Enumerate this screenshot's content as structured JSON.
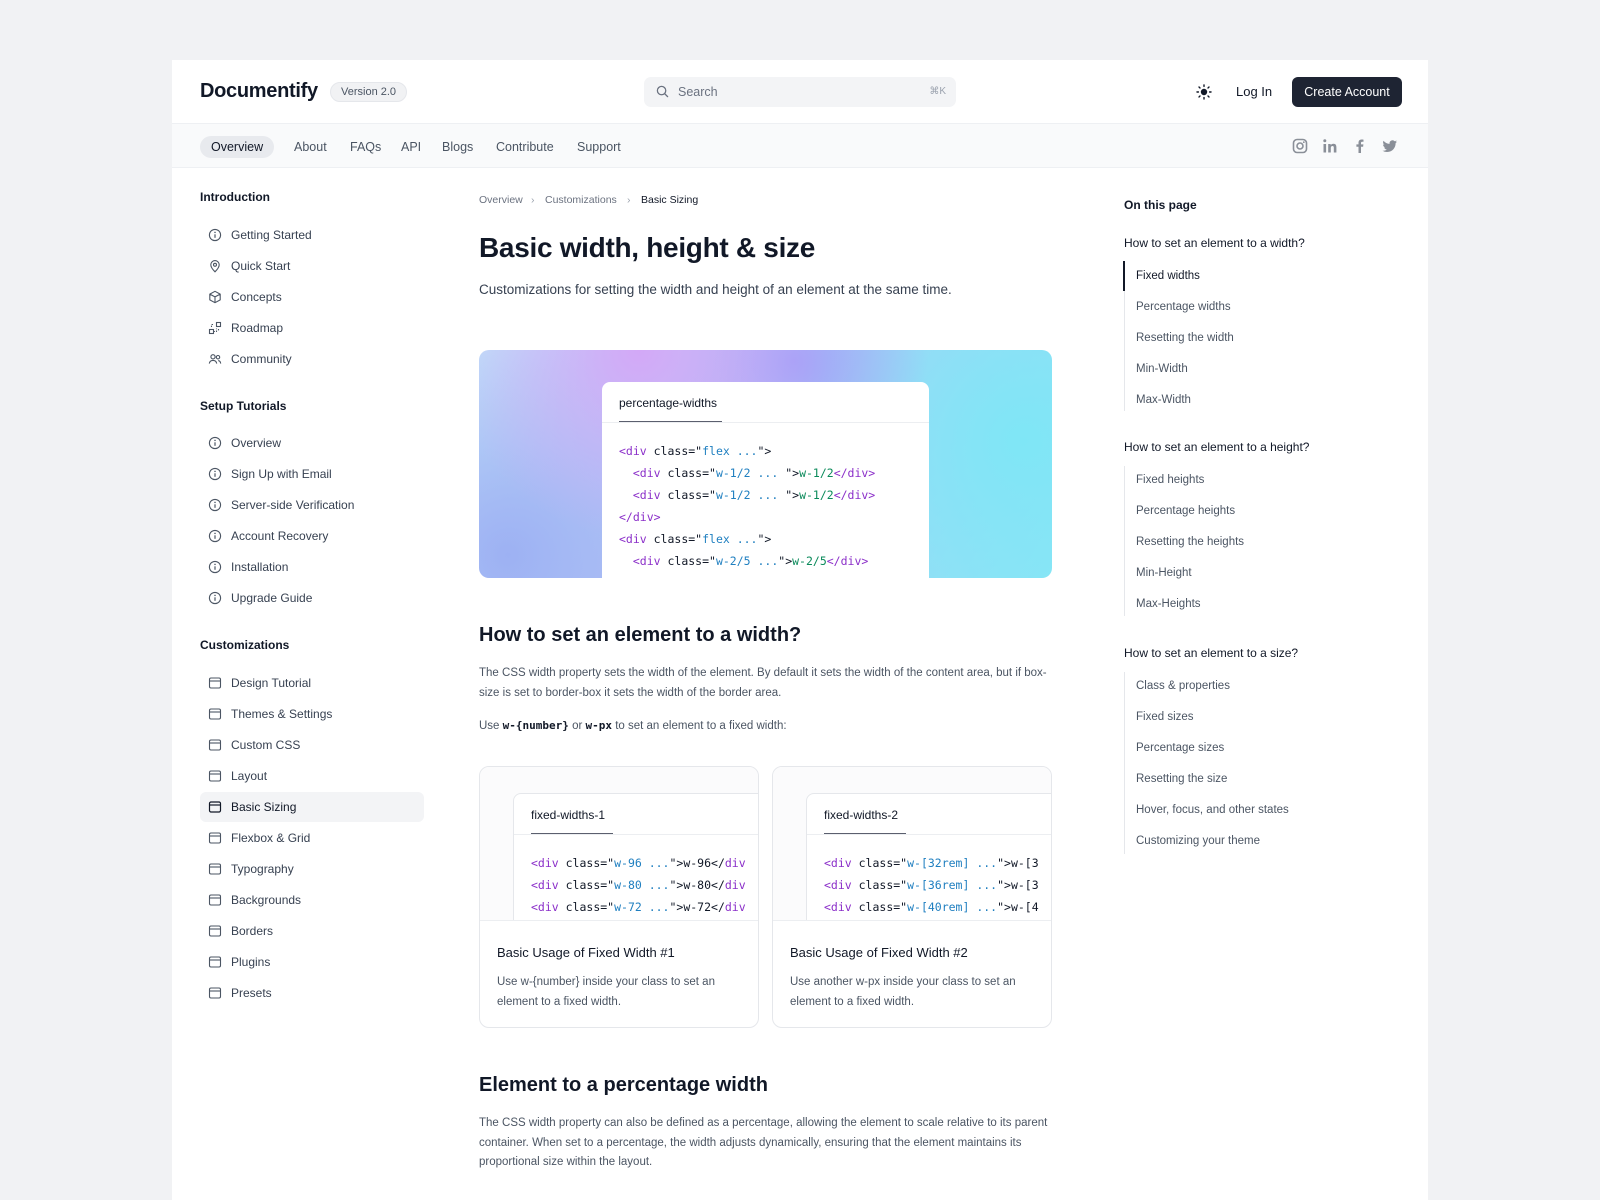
{
  "header": {
    "logo": "Documentify",
    "version": "Version 2.0",
    "search_placeholder": "Search",
    "search_shortcut": "⌘K",
    "login": "Log In",
    "create_account": "Create Account"
  },
  "nav": {
    "tabs": [
      "Overview",
      "About",
      "FAQs",
      "API",
      "Blogs",
      "Contribute",
      "Support"
    ],
    "active": "Overview",
    "social_icons": [
      "instagram-icon",
      "linkedin-icon",
      "facebook-icon",
      "twitter-icon"
    ]
  },
  "sidebar": {
    "groups": [
      {
        "title": "Introduction",
        "items": [
          {
            "label": "Getting Started",
            "icon": "info-icon"
          },
          {
            "label": "Quick Start",
            "icon": "map-pin-icon"
          },
          {
            "label": "Concepts",
            "icon": "cube-icon"
          },
          {
            "label": "Roadmap",
            "icon": "roadmap-icon"
          },
          {
            "label": "Community",
            "icon": "users-icon"
          }
        ]
      },
      {
        "title": "Setup Tutorials",
        "items": [
          {
            "label": "Overview",
            "icon": "info-icon"
          },
          {
            "label": "Sign Up with Email",
            "icon": "info-icon"
          },
          {
            "label": "Server-side Verification",
            "icon": "info-icon"
          },
          {
            "label": "Account Recovery",
            "icon": "info-icon"
          },
          {
            "label": "Installation",
            "icon": "info-icon"
          },
          {
            "label": "Upgrade Guide",
            "icon": "info-icon"
          }
        ]
      },
      {
        "title": "Customizations",
        "items": [
          {
            "label": "Design Tutorial",
            "icon": "window-icon"
          },
          {
            "label": "Themes & Settings",
            "icon": "window-icon"
          },
          {
            "label": "Custom CSS",
            "icon": "window-icon"
          },
          {
            "label": "Layout",
            "icon": "window-icon"
          },
          {
            "label": "Basic Sizing",
            "icon": "window-icon",
            "active": true
          },
          {
            "label": "Flexbox & Grid",
            "icon": "window-icon"
          },
          {
            "label": "Typography",
            "icon": "window-icon"
          },
          {
            "label": "Backgrounds",
            "icon": "window-icon"
          },
          {
            "label": "Borders",
            "icon": "window-icon"
          },
          {
            "label": "Plugins",
            "icon": "window-icon"
          },
          {
            "label": "Presets",
            "icon": "window-icon"
          }
        ]
      }
    ]
  },
  "main": {
    "breadcrumb": [
      "Overview",
      "Customizations",
      "Basic Sizing"
    ],
    "title": "Basic width, height & size",
    "lead": "Customizations for setting the width and height of an element at the same time.",
    "hero": {
      "tab": "percentage-widths",
      "code": [
        [
          [
            "t",
            "<div "
          ],
          [
            "p",
            "class=\""
          ],
          [
            "s",
            "flex ..."
          ],
          [
            "p",
            "\">"
          ]
        ],
        [
          [
            "p",
            "  "
          ],
          [
            "t",
            "<div "
          ],
          [
            "p",
            "class=\""
          ],
          [
            "s",
            "w-1/2 ... "
          ],
          [
            "p",
            "\">"
          ],
          [
            "g",
            "w-1/2"
          ],
          [
            "t",
            "</div>"
          ]
        ],
        [
          [
            "p",
            "  "
          ],
          [
            "t",
            "<div "
          ],
          [
            "p",
            "class=\""
          ],
          [
            "s",
            "w-1/2 ... "
          ],
          [
            "p",
            "\">"
          ],
          [
            "g",
            "w-1/2"
          ],
          [
            "t",
            "</div>"
          ]
        ],
        [
          [
            "t",
            "</div>"
          ]
        ],
        [
          [
            "t",
            "<div "
          ],
          [
            "p",
            "class=\""
          ],
          [
            "s",
            "flex ..."
          ],
          [
            "p",
            "\">"
          ]
        ],
        [
          [
            "p",
            "  "
          ],
          [
            "t",
            "<div "
          ],
          [
            "p",
            "class=\""
          ],
          [
            "s",
            "w-2/5 ..."
          ],
          [
            "p",
            "\">"
          ],
          [
            "g",
            "w-2/5"
          ],
          [
            "t",
            "</div>"
          ]
        ]
      ]
    },
    "section1": {
      "heading": "How to set an element to a width?",
      "para": "The CSS width property sets the width of the element. By default it sets the width of the content area, but if box-size is set to border-box it sets the width of the border area.",
      "use_prefix": "Use ",
      "use_code1": "w-{number}",
      "use_mid": " or ",
      "use_code2": "w-px",
      "use_suffix": " to set an element to a fixed width:"
    },
    "cards": [
      {
        "tab": "fixed-widths-1",
        "code": [
          [
            [
              "t",
              "<div "
            ],
            [
              "p",
              "class=\""
            ],
            [
              "s",
              "w-96 ..."
            ],
            [
              "p",
              "\">w-96</"
            ],
            [
              "t",
              "div"
            ]
          ],
          [
            [
              "t",
              "<div "
            ],
            [
              "p",
              "class=\""
            ],
            [
              "s",
              "w-80 ..."
            ],
            [
              "p",
              "\">w-80</"
            ],
            [
              "t",
              "div"
            ]
          ],
          [
            [
              "t",
              "<div "
            ],
            [
              "p",
              "class=\""
            ],
            [
              "s",
              "w-72 ..."
            ],
            [
              "p",
              "\">w-72</"
            ],
            [
              "t",
              "div"
            ]
          ]
        ],
        "title": "Basic Usage of Fixed Width #1",
        "desc": "Use w-{number} inside your class to set an element to a fixed width."
      },
      {
        "tab": "fixed-widths-2",
        "code": [
          [
            [
              "t",
              "<div "
            ],
            [
              "p",
              "class=\""
            ],
            [
              "s",
              "w-[32rem] ..."
            ],
            [
              "p",
              "\">w-[3"
            ]
          ],
          [
            [
              "t",
              "<div "
            ],
            [
              "p",
              "class=\""
            ],
            [
              "s",
              "w-[36rem] ..."
            ],
            [
              "p",
              "\">w-[3"
            ]
          ],
          [
            [
              "t",
              "<div "
            ],
            [
              "p",
              "class=\""
            ],
            [
              "s",
              "w-[40rem] ..."
            ],
            [
              "p",
              "\">w-[4"
            ]
          ]
        ],
        "title": "Basic Usage of Fixed Width #2",
        "desc": "Use another w-px inside your class to set an element to a fixed width."
      }
    ],
    "section2": {
      "heading": "Element to a percentage width",
      "para": "The CSS width property can also be defined as a percentage, allowing the element to scale relative to its parent container. When set to a percentage, the width adjusts dynamically, ensuring that the element maintains its proportional size within the layout."
    }
  },
  "toc": {
    "title": "On this page",
    "sections": [
      {
        "heading": "How to set an element to a width?",
        "items": [
          "Fixed widths",
          "Percentage widths",
          "Resetting the width",
          "Min-Width",
          "Max-Width"
        ],
        "active": "Fixed widths"
      },
      {
        "heading": "How to set an element to a height?",
        "items": [
          "Fixed heights",
          "Percentage heights",
          "Resetting the heights",
          "Min-Height",
          "Max-Heights"
        ]
      },
      {
        "heading": "How to set an element to a size?",
        "items": [
          "Class & properties",
          "Fixed sizes",
          "Percentage sizes",
          "Resetting the size",
          "Hover, focus, and other states",
          "Customizing your theme"
        ]
      }
    ]
  }
}
